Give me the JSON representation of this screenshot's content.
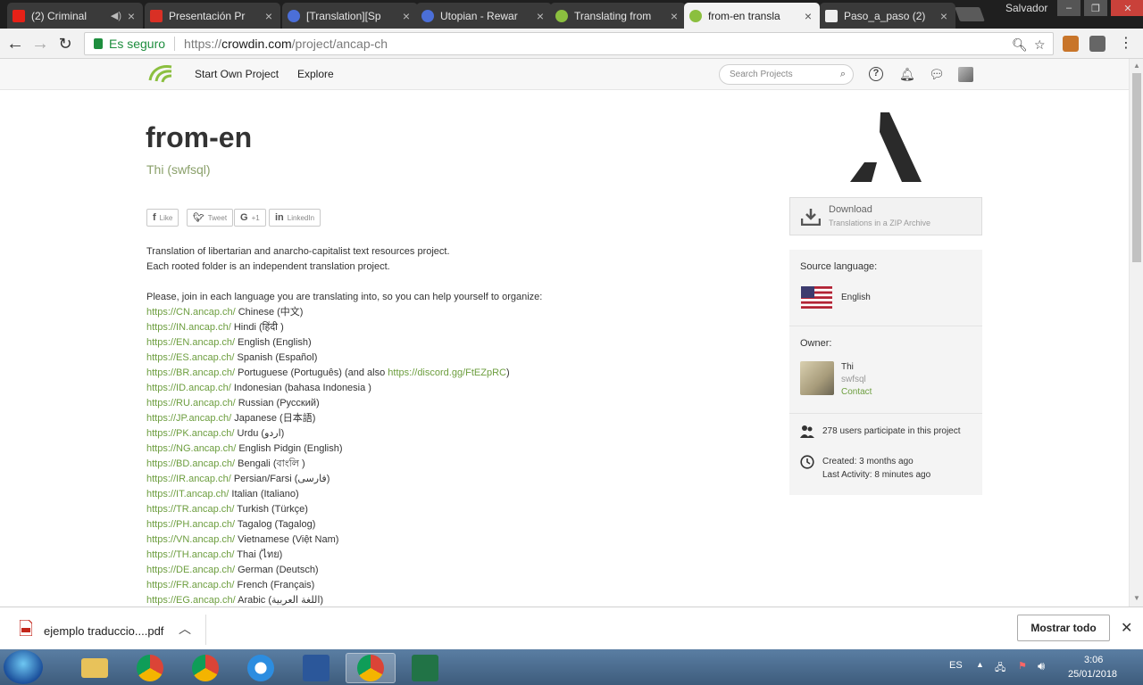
{
  "browser": {
    "tabs": [
      {
        "title": "(2) Criminal",
        "favicon_color": "#e62117"
      },
      {
        "title": "Presentación Pr",
        "favicon_color": "#d93025"
      },
      {
        "title": "[Translation][Sp",
        "favicon_color": "#4b6fd8"
      },
      {
        "title": "Utopian - Rewar",
        "favicon_color": "#4b6fd8"
      },
      {
        "title": "Translating from",
        "favicon_color": "#8bbf3f"
      },
      {
        "title": "from-en transla",
        "favicon_color": "#8bbf3f"
      },
      {
        "title": "Paso_a_paso (2)",
        "favicon_color": "#eeeeee"
      }
    ],
    "window_user": "Salvador",
    "address": {
      "secure_label": "Es seguro",
      "url_scheme": "https://",
      "url_host": "crowdin.com",
      "url_path": "/project/ancap-ch"
    }
  },
  "site": {
    "nav": {
      "start_own_project": "Start Own Project",
      "explore": "Explore"
    },
    "search": {
      "placeholder": "Search Projects"
    }
  },
  "project": {
    "title": "from-en",
    "owner_line": "Thi (swfsql)",
    "share": {
      "like": "Like",
      "tweet": "Tweet",
      "gplus": "+1",
      "linkedin": "LinkedIn"
    },
    "description": {
      "line1": "Translation of libertarian and anarcho-capitalist text resources project.",
      "line2": "Each rooted folder is an independent translation project.",
      "line3": "Please, join in each language you are translating into, so you can help yourself to organize:",
      "languages": [
        {
          "url": "https://CN.ancap.ch/",
          "name": "Chinese (中文)"
        },
        {
          "url": "https://IN.ancap.ch/",
          "name": "Hindi (हिंदी )"
        },
        {
          "url": "https://EN.ancap.ch/",
          "name": "English (English)"
        },
        {
          "url": "https://ES.ancap.ch/",
          "name": "Spanish (Español)"
        },
        {
          "url": "https://BR.ancap.ch/",
          "name": "Portuguese (Português) (and also",
          "extra_link": "https://discord.gg/FtEZpRC",
          "extra_suffix": ")"
        },
        {
          "url": "https://ID.ancap.ch/",
          "name": "Indonesian (bahasa Indonesia )"
        },
        {
          "url": "https://RU.ancap.ch/",
          "name": "Russian (Русский)"
        },
        {
          "url": "https://JP.ancap.ch/",
          "name": "Japanese (日本語)"
        },
        {
          "url": "https://PK.ancap.ch/",
          "name": "Urdu (اردو)"
        },
        {
          "url": "https://NG.ancap.ch/",
          "name": "English Pidgin (English)"
        },
        {
          "url": "https://BD.ancap.ch/",
          "name": "Bengali (বাংলি )"
        },
        {
          "url": "https://IR.ancap.ch/",
          "name": "Persian/Farsi (فارسی)"
        },
        {
          "url": "https://IT.ancap.ch/",
          "name": "Italian (Italiano)"
        },
        {
          "url": "https://TR.ancap.ch/",
          "name": "Turkish (Türkçe)"
        },
        {
          "url": "https://PH.ancap.ch/",
          "name": "Tagalog (Tagalog)"
        },
        {
          "url": "https://VN.ancap.ch/",
          "name": "Vietnamese (Việt Nam)"
        },
        {
          "url": "https://TH.ancap.ch/",
          "name": "Thai (ไทย)"
        },
        {
          "url": "https://DE.ancap.ch/",
          "name": "German (Deutsch)"
        },
        {
          "url": "https://FR.ancap.ch/",
          "name": "French (Français)"
        },
        {
          "url": "https://EG.ancap.ch/",
          "name": "Arabic (اللغة العربية)"
        }
      ]
    }
  },
  "sidebar": {
    "download": {
      "title": "Download",
      "subtitle": "Translations in a ZIP Archive"
    },
    "source_language_label": "Source language:",
    "source_language": "English",
    "owner_label": "Owner:",
    "owner_name": "Thi",
    "owner_login": "swfsql",
    "owner_contact": "Contact",
    "participants": "278 users participate in this project",
    "created": "Created: 3 months ago",
    "last_activity": "Last Activity: 8 minutes ago"
  },
  "downloads_shelf": {
    "file_name": "ejemplo traduccio....pdf",
    "show_all": "Mostrar todo"
  },
  "taskbar": {
    "language": "ES",
    "time": "3:06",
    "date": "25/01/2018"
  },
  "colors": {
    "link_green": "#6d9e3f",
    "secure_green": "#1e8e3e"
  }
}
